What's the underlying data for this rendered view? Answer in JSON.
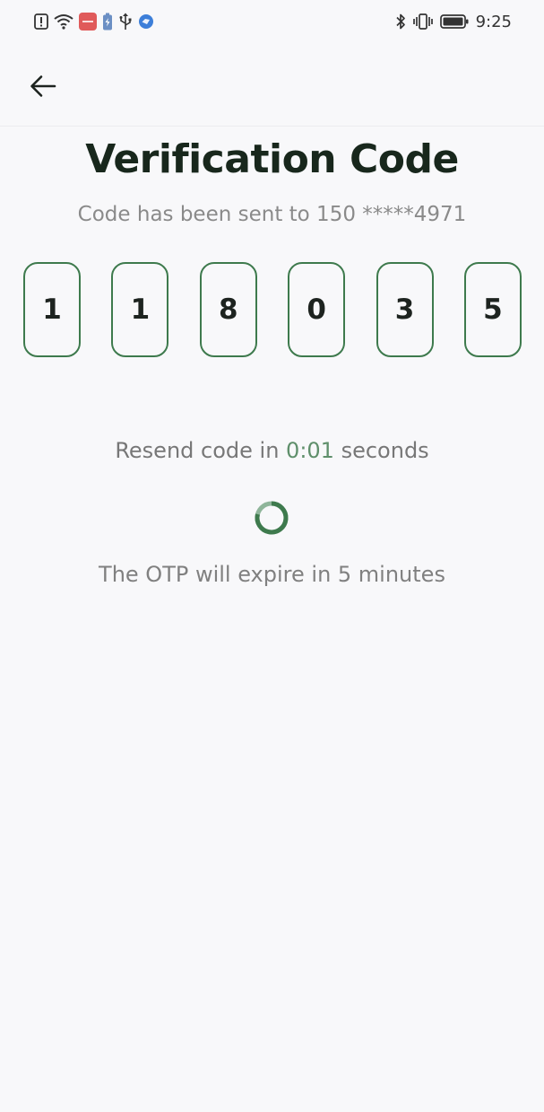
{
  "status_bar": {
    "time": "9:25",
    "left_icons": [
      "alert-icon",
      "wifi-icon",
      "app-notification-icon",
      "battery-saver-icon",
      "usb-icon",
      "app-badge-icon"
    ],
    "right_icons": [
      "bluetooth-icon",
      "vibrate-icon",
      "battery-icon"
    ]
  },
  "header": {
    "back_icon": "arrow-left-icon"
  },
  "verification": {
    "title": "Verification Code",
    "subtitle": "Code has been sent to 150 *****4971",
    "digits": [
      "1",
      "1",
      "8",
      "0",
      "3",
      "5"
    ],
    "resend_prefix": "Resend code in ",
    "resend_count": "0:01",
    "resend_suffix": " seconds",
    "expire_text": "The OTP will expire in 5 minutes"
  },
  "colors": {
    "accent": "#3e7a4d",
    "title": "#18271c",
    "countdown": "#5f8f6b",
    "background": "#f8f8fa"
  }
}
